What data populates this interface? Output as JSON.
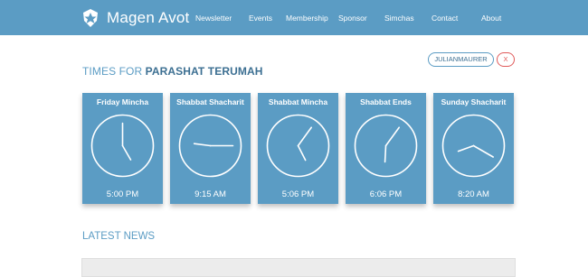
{
  "brand": {
    "name": "Magen Avot",
    "logo_icon": "shield-star-icon"
  },
  "nav": {
    "items": [
      "Newsletter",
      "Events",
      "Membership",
      "Sponsor",
      "Simchas",
      "Contact",
      "About"
    ]
  },
  "user": {
    "username": "JULIANMAURER",
    "logout_label": "X"
  },
  "times_section": {
    "title_prefix": "TIMES FOR",
    "title_parsha": "PARASHAT TERUMAH",
    "cards": [
      {
        "label": "Friday Mincha",
        "time": "5:00 PM",
        "hour": 5,
        "minute": 0
      },
      {
        "label": "Shabbat Shacharit",
        "time": "9:15 AM",
        "hour": 9,
        "minute": 15
      },
      {
        "label": "Shabbat Mincha",
        "time": "5:06 PM",
        "hour": 5,
        "minute": 6
      },
      {
        "label": "Shabbat Ends",
        "time": "6:06 PM",
        "hour": 6,
        "minute": 6
      },
      {
        "label": "Sunday Shacharit",
        "time": "8:20 AM",
        "hour": 8,
        "minute": 20
      }
    ]
  },
  "news_section": {
    "title": "LATEST NEWS"
  },
  "colors": {
    "primary": "#5b9cc4",
    "primary_dark": "#3c6f92",
    "danger": "#e05a5a",
    "background": "#ffffff"
  }
}
